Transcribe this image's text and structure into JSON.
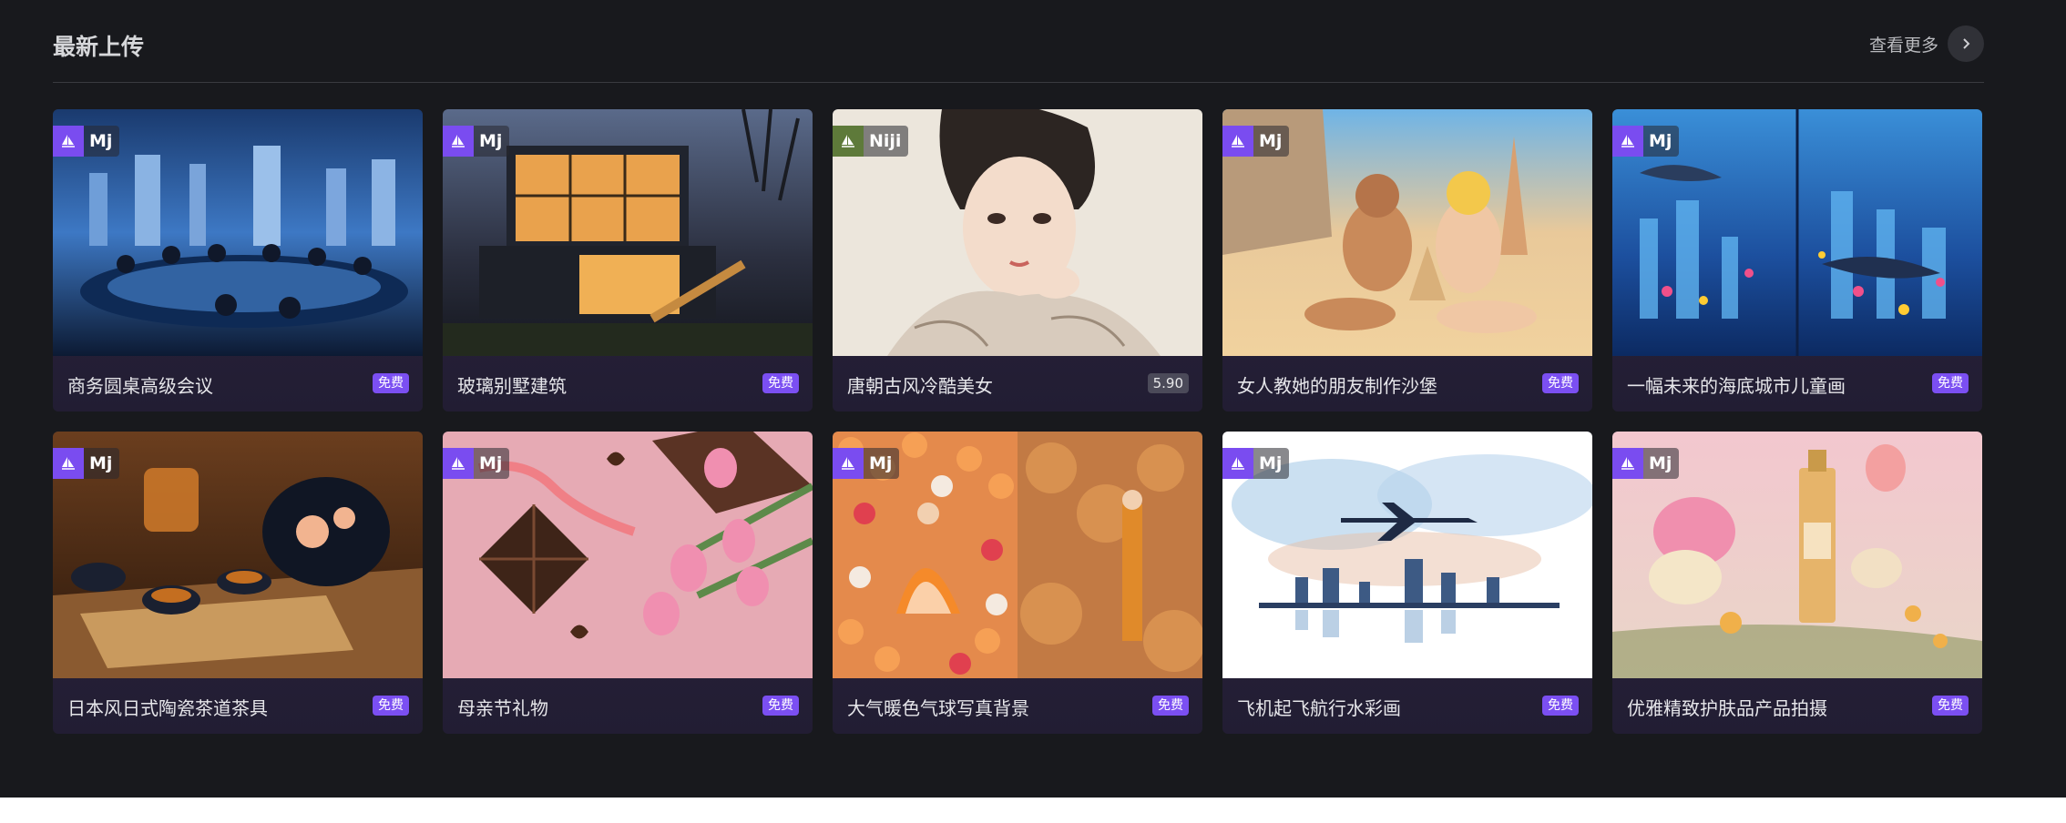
{
  "section": {
    "title": "最新上传",
    "more_label": "查看更多"
  },
  "cards": [
    {
      "title": "商务圆桌高级会议",
      "model": "Mj",
      "price": "免费"
    },
    {
      "title": "玻璃别墅建筑",
      "model": "Mj",
      "price": "免费"
    },
    {
      "title": "唐朝古风冷酷美女",
      "model": "Niji",
      "price": "5.90"
    },
    {
      "title": "女人教她的朋友制作沙堡",
      "model": "Mj",
      "price": "免费"
    },
    {
      "title": "一幅未来的海底城市儿童画",
      "model": "Mj",
      "price": "免费"
    },
    {
      "title": "日本风日式陶瓷茶道茶具",
      "model": "Mj",
      "price": "免费"
    },
    {
      "title": "母亲节礼物",
      "model": "Mj",
      "price": "免费"
    },
    {
      "title": "大气暖色气球写真背景",
      "model": "Mj",
      "price": "免费"
    },
    {
      "title": "飞机起飞航行水彩画",
      "model": "Mj",
      "price": "免费"
    },
    {
      "title": "优雅精致护肤品产品拍摄",
      "model": "Mj",
      "price": "免费"
    }
  ],
  "colors": {
    "background": "#18191d",
    "accent": "#7b4ff2",
    "card_footer": "#2b2640"
  },
  "icons": {
    "more": "chevron-right-icon",
    "model": "sailboat-icon"
  }
}
